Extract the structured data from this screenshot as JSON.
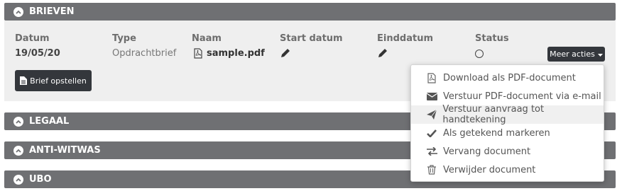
{
  "sections": {
    "brieven": "BRIEVEN",
    "legaal": "LEGAAL",
    "anti_witwas": "ANTI-WITWAS",
    "ubo": "UBO"
  },
  "table": {
    "headers": {
      "datum": "Datum",
      "type": "Type",
      "naam": "Naam",
      "start_datum": "Start datum",
      "einddatum": "Einddatum",
      "status": "Status"
    },
    "row": {
      "datum": "19/05/20",
      "type": "Opdrachtbrief",
      "naam": "sample.pdf"
    }
  },
  "buttons": {
    "brief_opstellen": "Brief opstellen",
    "meer_acties": "Meer acties"
  },
  "menu": [
    {
      "label": "Download als PDF-document",
      "icon": "pdf-file-icon"
    },
    {
      "label": "Verstuur PDF-document via e-mail",
      "icon": "envelope-icon"
    },
    {
      "label": "Verstuur aanvraag tot handtekening",
      "icon": "paper-plane-icon"
    },
    {
      "label": "Als getekend markeren",
      "icon": "checkmark-icon"
    },
    {
      "label": "Vervang document",
      "icon": "exchange-icon"
    },
    {
      "label": "Verwijder document",
      "icon": "trash-icon"
    }
  ],
  "colors": {
    "header_bg": "#6f7073",
    "panel_bg": "#efefef",
    "button_dark": "#34373c"
  }
}
